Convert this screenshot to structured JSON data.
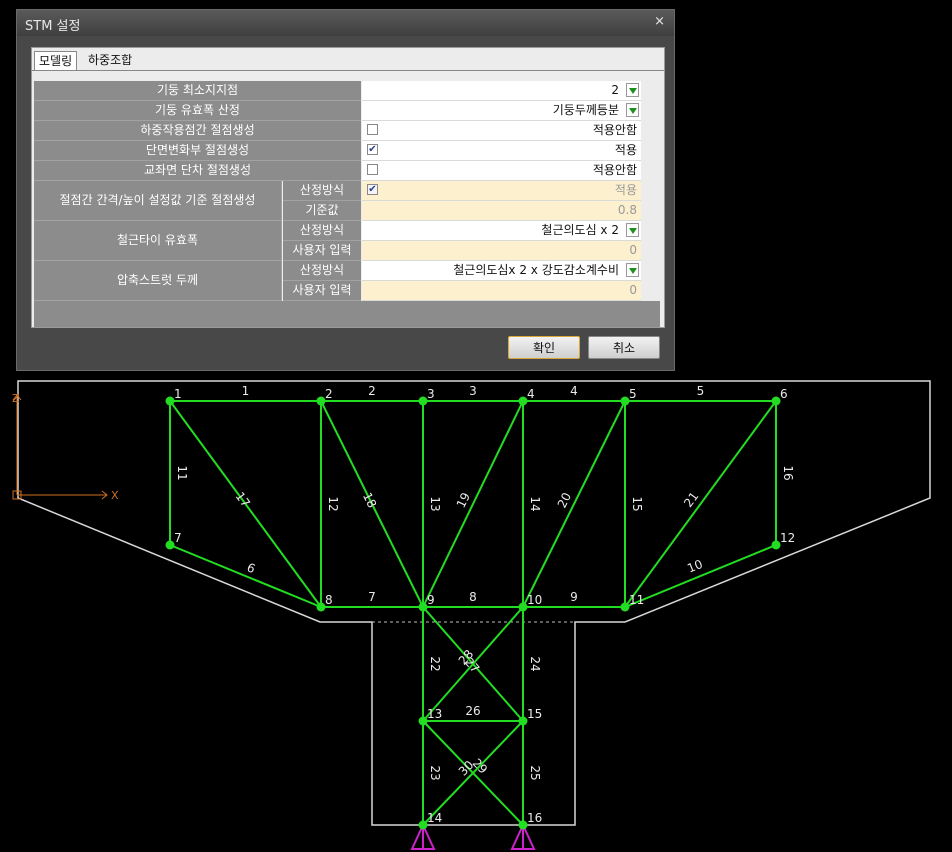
{
  "dialog": {
    "title": "STM 설정",
    "close": "×",
    "tabs": [
      "모델링",
      "하중조합"
    ],
    "rows": [
      {
        "label": "기둥 최소지지점",
        "value": "2",
        "control": "dropdown"
      },
      {
        "label": "기둥 유효폭 산정",
        "value": "기둥두께등분",
        "control": "dropdown"
      },
      {
        "label": "하중작용점간 절점생성",
        "value": "적용안함",
        "checked": false
      },
      {
        "label": "단면변화부 절점생성",
        "value": "적용",
        "checked": true
      },
      {
        "label": "교좌면 단차 절점생성",
        "value": "적용안함",
        "checked": false
      }
    ],
    "groups": [
      {
        "label": "절점간 간격/높이 설정값 기준 절점생성",
        "sub": [
          {
            "label": "산정방식",
            "value": "적용",
            "checked": true,
            "disabled": true
          },
          {
            "label": "기준값",
            "value": "0.8",
            "disabled": true
          }
        ]
      },
      {
        "label": "철근타이 유효폭",
        "sub": [
          {
            "label": "산정방식",
            "value": "철근의도심 x 2",
            "control": "dropdown"
          },
          {
            "label": "사용자 입력",
            "value": "0",
            "disabled": true
          }
        ]
      },
      {
        "label": "압축스트럿 두께",
        "sub": [
          {
            "label": "산정방식",
            "value": "철근의도심x 2 x 강도감소계수비",
            "control": "dropdown"
          },
          {
            "label": "사용자 입력",
            "value": "0",
            "disabled": true
          }
        ]
      }
    ],
    "ok": "확인",
    "cancel": "취소"
  },
  "model": {
    "axis": {
      "z": "Z",
      "x": "X"
    },
    "colors": {
      "outline": "#d8d8d8",
      "member": "#22dd22",
      "support": "#cc22cc",
      "axis": "#d07020"
    },
    "node_labels": [
      "1",
      "2",
      "3",
      "4",
      "5",
      "6",
      "7",
      "8",
      "9",
      "10",
      "11",
      "12",
      "13",
      "14",
      "15",
      "16"
    ],
    "member_labels": [
      "1",
      "2",
      "3",
      "4",
      "5",
      "6",
      "7",
      "8",
      "9",
      "10",
      "11",
      "12",
      "13",
      "14",
      "15",
      "16",
      "17",
      "18",
      "19",
      "20",
      "21",
      "22",
      "23",
      "24",
      "25",
      "26",
      "27",
      "28",
      "29",
      "30"
    ]
  }
}
